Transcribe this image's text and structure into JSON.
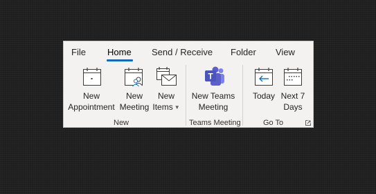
{
  "tabs": [
    {
      "label": "File"
    },
    {
      "label": "Home"
    },
    {
      "label": "Send / Receive"
    },
    {
      "label": "Folder"
    },
    {
      "label": "View"
    }
  ],
  "active_tab": "Home",
  "groups": {
    "new": {
      "label": "New",
      "buttons": {
        "new_appointment": {
          "line1": "New",
          "line2": "Appointment",
          "icon": "calendar-dot-icon"
        },
        "new_meeting": {
          "line1": "New",
          "line2": "Meeting",
          "icon": "calendar-people-icon"
        },
        "new_items": {
          "line1": "New",
          "line2": "Items",
          "icon": "calendar-mail-icon",
          "has_dropdown": true
        }
      }
    },
    "teams": {
      "label": "Teams Meeting",
      "buttons": {
        "new_teams_meeting": {
          "line1": "New Teams",
          "line2": "Meeting",
          "icon": "teams-icon"
        }
      }
    },
    "goto": {
      "label": "Go To",
      "buttons": {
        "today": {
          "line1": "Today",
          "icon": "calendar-today-arrow-icon"
        },
        "next7": {
          "line1": "Next 7",
          "line2": "Days",
          "icon": "calendar-week-icon"
        }
      }
    }
  },
  "colors": {
    "accent": "#0f6cbd",
    "teams_purple": "#5b5fc7",
    "ribbon_bg": "#f3f2f1",
    "background": "#1f1f1f"
  }
}
